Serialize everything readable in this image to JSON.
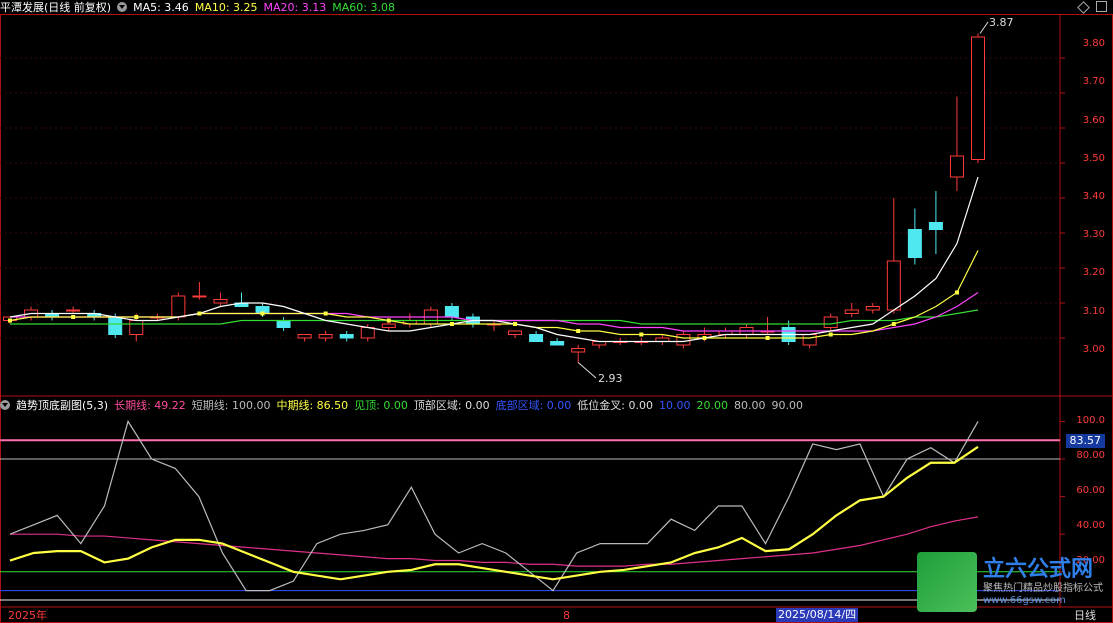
{
  "header": {
    "stock": "平潭发展(日线 前复权)",
    "ma5": "MA5: 3.46",
    "ma10": "MA10: 3.25",
    "ma20": "MA20: 3.13",
    "ma60": "MA60: 3.08"
  },
  "sub_header": {
    "title": "趋势顶底副图(5,3)",
    "long": "长期线: 49.22",
    "short": "短期线: 100.00",
    "mid": "中期线: 86.50",
    "see_top": "见顶: 0.00",
    "top_zone": "顶部区域: 0.00",
    "bottom_zone": "底部区域: 0.00",
    "gold_cross": "低位金叉: 0.00",
    "l10": "10.00",
    "l20": "20.00",
    "l80": "80.00",
    "l90": "90.00"
  },
  "price_axis": [
    "3.80",
    "3.70",
    "3.60",
    "3.50",
    "3.40",
    "3.30",
    "3.20",
    "3.10",
    "3.00"
  ],
  "osc_axis": [
    "100.0",
    "80.00",
    "60.00",
    "40.00",
    "20.00"
  ],
  "osc_value_tag": "83.57",
  "annotations": {
    "high": "3.87",
    "low": "2.93"
  },
  "time_axis": {
    "year": "2025年",
    "month": "8",
    "date": "2025/08/14/四",
    "period": "日线"
  },
  "watermark": {
    "brand": "立六公式网",
    "slogan": "聚焦热门精品炒股指标公式",
    "url": "www.66gsw.com"
  },
  "colors": {
    "up": "#ff3b3b",
    "down": "#4fe7f0",
    "ma5": "#ffffff",
    "ma10": "#ffff44",
    "ma20": "#ff44ff",
    "ma60": "#33dd33"
  },
  "chart_data": {
    "type": "candlestick",
    "ylim": [
      2.88,
      3.88
    ],
    "candles": [
      {
        "o": 3.05,
        "h": 3.06,
        "l": 3.04,
        "c": 3.06
      },
      {
        "o": 3.06,
        "h": 3.09,
        "l": 3.05,
        "c": 3.08
      },
      {
        "o": 3.07,
        "h": 3.08,
        "l": 3.05,
        "c": 3.06
      },
      {
        "o": 3.08,
        "h": 3.09,
        "l": 3.07,
        "c": 3.08
      },
      {
        "o": 3.07,
        "h": 3.08,
        "l": 3.05,
        "c": 3.06
      },
      {
        "o": 3.06,
        "h": 3.07,
        "l": 3.0,
        "c": 3.01
      },
      {
        "o": 3.01,
        "h": 3.07,
        "l": 2.99,
        "c": 3.05
      },
      {
        "o": 3.06,
        "h": 3.07,
        "l": 3.05,
        "c": 3.06
      },
      {
        "o": 3.06,
        "h": 3.13,
        "l": 3.05,
        "c": 3.12
      },
      {
        "o": 3.12,
        "h": 3.16,
        "l": 3.11,
        "c": 3.12
      },
      {
        "o": 3.1,
        "h": 3.13,
        "l": 3.09,
        "c": 3.11
      },
      {
        "o": 3.1,
        "h": 3.13,
        "l": 3.09,
        "c": 3.09
      },
      {
        "o": 3.09,
        "h": 3.1,
        "l": 3.06,
        "c": 3.07
      },
      {
        "o": 3.05,
        "h": 3.06,
        "l": 3.02,
        "c": 3.03
      },
      {
        "o": 3.0,
        "h": 3.01,
        "l": 2.99,
        "c": 3.01
      },
      {
        "o": 3.0,
        "h": 3.02,
        "l": 2.99,
        "c": 3.01
      },
      {
        "o": 3.01,
        "h": 3.02,
        "l": 2.99,
        "c": 3.0
      },
      {
        "o": 3.0,
        "h": 3.04,
        "l": 2.99,
        "c": 3.03
      },
      {
        "o": 3.03,
        "h": 3.05,
        "l": 3.02,
        "c": 3.04
      },
      {
        "o": 3.04,
        "h": 3.07,
        "l": 3.03,
        "c": 3.05
      },
      {
        "o": 3.04,
        "h": 3.09,
        "l": 3.03,
        "c": 3.08
      },
      {
        "o": 3.09,
        "h": 3.1,
        "l": 3.05,
        "c": 3.06
      },
      {
        "o": 3.06,
        "h": 3.07,
        "l": 3.03,
        "c": 3.04
      },
      {
        "o": 3.04,
        "h": 3.05,
        "l": 3.02,
        "c": 3.04
      },
      {
        "o": 3.01,
        "h": 3.02,
        "l": 3.0,
        "c": 3.02
      },
      {
        "o": 3.01,
        "h": 3.02,
        "l": 2.99,
        "c": 2.99
      },
      {
        "o": 2.99,
        "h": 3.0,
        "l": 2.98,
        "c": 2.98
      },
      {
        "o": 2.96,
        "h": 2.98,
        "l": 2.93,
        "c": 2.97
      },
      {
        "o": 2.98,
        "h": 2.99,
        "l": 2.97,
        "c": 2.99
      },
      {
        "o": 2.99,
        "h": 3.0,
        "l": 2.98,
        "c": 2.99
      },
      {
        "o": 2.99,
        "h": 3.0,
        "l": 2.98,
        "c": 2.99
      },
      {
        "o": 2.99,
        "h": 3.01,
        "l": 2.98,
        "c": 3.0
      },
      {
        "o": 2.98,
        "h": 3.02,
        "l": 2.97,
        "c": 3.01
      },
      {
        "o": 3.0,
        "h": 3.03,
        "l": 2.99,
        "c": 3.01
      },
      {
        "o": 3.01,
        "h": 3.03,
        "l": 3.0,
        "c": 3.02
      },
      {
        "o": 3.01,
        "h": 3.04,
        "l": 3.0,
        "c": 3.03
      },
      {
        "o": 3.02,
        "h": 3.06,
        "l": 3.01,
        "c": 3.02
      },
      {
        "o": 3.03,
        "h": 3.05,
        "l": 2.98,
        "c": 2.99
      },
      {
        "o": 2.98,
        "h": 3.01,
        "l": 2.97,
        "c": 3.01
      },
      {
        "o": 3.03,
        "h": 3.07,
        "l": 3.02,
        "c": 3.06
      },
      {
        "o": 3.07,
        "h": 3.1,
        "l": 3.06,
        "c": 3.08
      },
      {
        "o": 3.08,
        "h": 3.1,
        "l": 3.07,
        "c": 3.09
      },
      {
        "o": 3.08,
        "h": 3.4,
        "l": 3.07,
        "c": 3.22
      },
      {
        "o": 3.31,
        "h": 3.37,
        "l": 3.21,
        "c": 3.23
      },
      {
        "o": 3.33,
        "h": 3.42,
        "l": 3.24,
        "c": 3.31
      },
      {
        "o": 3.46,
        "h": 3.69,
        "l": 3.42,
        "c": 3.52
      },
      {
        "o": 3.51,
        "h": 3.87,
        "l": 3.5,
        "c": 3.86
      }
    ],
    "ma5": [
      3.06,
      3.07,
      3.07,
      3.07,
      3.07,
      3.06,
      3.05,
      3.05,
      3.06,
      3.07,
      3.09,
      3.1,
      3.1,
      3.09,
      3.07,
      3.05,
      3.04,
      3.03,
      3.02,
      3.02,
      3.03,
      3.04,
      3.05,
      3.05,
      3.04,
      3.03,
      3.01,
      3.0,
      2.99,
      2.99,
      2.99,
      2.99,
      2.99,
      3.0,
      3.01,
      3.01,
      3.01,
      3.01,
      3.01,
      3.02,
      3.03,
      3.04,
      3.08,
      3.12,
      3.17,
      3.27,
      3.46
    ],
    "ma10": [
      3.05,
      3.06,
      3.06,
      3.06,
      3.06,
      3.06,
      3.06,
      3.06,
      3.06,
      3.07,
      3.07,
      3.07,
      3.07,
      3.07,
      3.07,
      3.07,
      3.06,
      3.06,
      3.05,
      3.04,
      3.04,
      3.04,
      3.04,
      3.04,
      3.04,
      3.03,
      3.03,
      3.02,
      3.02,
      3.01,
      3.01,
      3.01,
      3.0,
      3.0,
      3.0,
      3.0,
      3.0,
      3.0,
      3.0,
      3.01,
      3.01,
      3.02,
      3.04,
      3.06,
      3.09,
      3.13,
      3.25
    ],
    "ma20": [
      3.06,
      3.06,
      3.06,
      3.06,
      3.06,
      3.06,
      3.06,
      3.06,
      3.06,
      3.07,
      3.07,
      3.07,
      3.07,
      3.07,
      3.07,
      3.07,
      3.07,
      3.06,
      3.06,
      3.06,
      3.06,
      3.06,
      3.05,
      3.05,
      3.05,
      3.05,
      3.05,
      3.04,
      3.04,
      3.03,
      3.03,
      3.03,
      3.02,
      3.02,
      3.02,
      3.02,
      3.02,
      3.02,
      3.02,
      3.02,
      3.02,
      3.02,
      3.03,
      3.04,
      3.06,
      3.09,
      3.13
    ],
    "ma60": [
      3.04,
      3.04,
      3.04,
      3.04,
      3.04,
      3.04,
      3.04,
      3.04,
      3.04,
      3.04,
      3.04,
      3.05,
      3.05,
      3.05,
      3.05,
      3.05,
      3.05,
      3.05,
      3.05,
      3.05,
      3.05,
      3.05,
      3.05,
      3.05,
      3.05,
      3.05,
      3.05,
      3.05,
      3.05,
      3.05,
      3.04,
      3.04,
      3.04,
      3.04,
      3.04,
      3.04,
      3.04,
      3.04,
      3.04,
      3.04,
      3.05,
      3.05,
      3.05,
      3.06,
      3.06,
      3.07,
      3.08
    ],
    "osc_ylim": [
      5,
      105
    ],
    "osc_short": [
      40,
      45,
      50,
      35,
      55,
      100,
      80,
      75,
      60,
      30,
      10,
      10,
      15,
      35,
      40,
      42,
      45,
      65,
      40,
      30,
      35,
      30,
      20,
      10,
      30,
      35,
      35,
      35,
      48,
      42,
      55,
      55,
      35,
      60,
      88,
      85,
      88,
      60,
      80,
      86,
      78,
      100
    ],
    "osc_mid": [
      26,
      30,
      31,
      31,
      25,
      27,
      33,
      37,
      37,
      35,
      30,
      25,
      20,
      18,
      16,
      18,
      20,
      21,
      24,
      24,
      22,
      20,
      18,
      16,
      18,
      20,
      21,
      23,
      25,
      30,
      33,
      38,
      31,
      32,
      40,
      50,
      58,
      60,
      70,
      78,
      78,
      86.5
    ],
    "osc_long": [
      40,
      40,
      40,
      39,
      39,
      38,
      37,
      36,
      35,
      34,
      33,
      32,
      31,
      30,
      29,
      28,
      27,
      27,
      26,
      26,
      25,
      25,
      24,
      24,
      23,
      23,
      23,
      24,
      24,
      25,
      26,
      27,
      28,
      29,
      30,
      32,
      34,
      37,
      40,
      44,
      47,
      49.22
    ]
  }
}
